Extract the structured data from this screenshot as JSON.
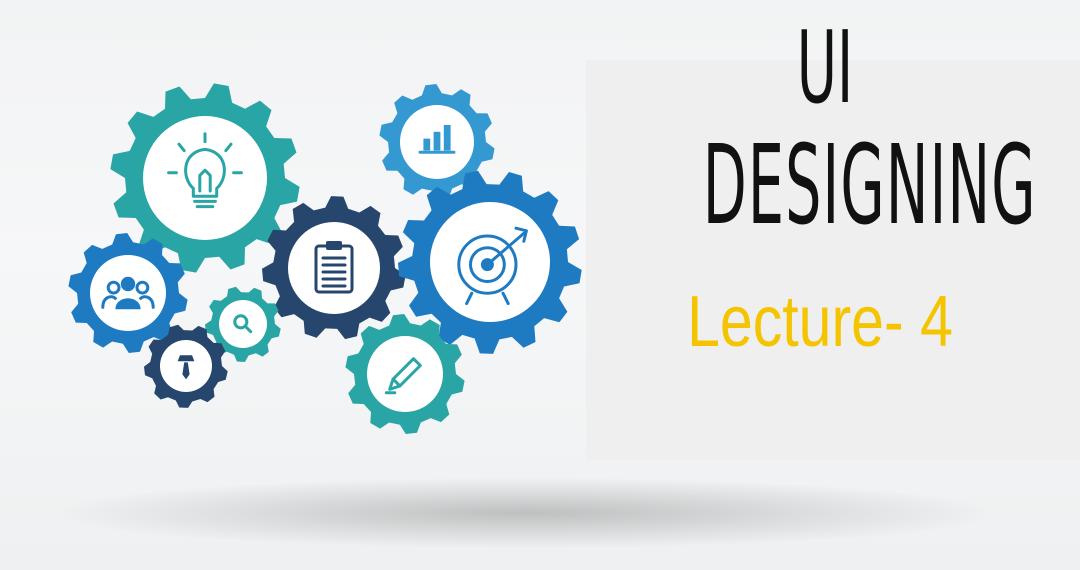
{
  "title": {
    "line1": "UI",
    "line2": "DESIGNING",
    "subtitle": "Lecture- 4"
  },
  "colors": {
    "teal": "#2aa5a5",
    "blue": "#1f7bc1",
    "light_blue": "#3599d1",
    "navy": "#26466d",
    "subtitle_yellow": "#f4c400",
    "title_black": "#111111"
  },
  "gears": [
    {
      "icon": "lightbulb-icon",
      "color": "teal"
    },
    {
      "icon": "bar-chart-icon",
      "color": "light_blue"
    },
    {
      "icon": "clipboard-icon",
      "color": "navy"
    },
    {
      "icon": "target-icon",
      "color": "blue"
    },
    {
      "icon": "team-icon",
      "color": "blue"
    },
    {
      "icon": "search-icon",
      "color": "teal"
    },
    {
      "icon": "businessman-icon",
      "color": "navy"
    },
    {
      "icon": "pencil-icon",
      "color": "teal"
    }
  ]
}
